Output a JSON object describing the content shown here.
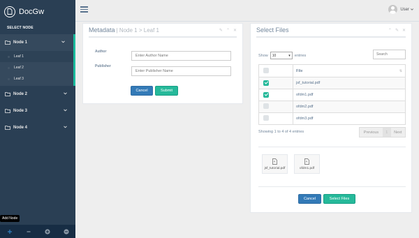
{
  "app": {
    "name": "DocGw"
  },
  "sidebar": {
    "heading": "SELECT NODE",
    "nodes": [
      {
        "label": "Node 1",
        "leaves": [
          {
            "label": "Leaf 1"
          },
          {
            "label": "Leaf 2"
          },
          {
            "label": "Leaf 3"
          }
        ]
      },
      {
        "label": "Node 2"
      },
      {
        "label": "Node 3"
      },
      {
        "label": "Node 4"
      }
    ],
    "tooltip": "Add Node"
  },
  "header": {
    "user": "User"
  },
  "metadata": {
    "title": "Metadata",
    "breadcrumb": "| Node 1 > Leaf 1",
    "author_label": "Author",
    "author_placeholder": "Enter Author Name",
    "publisher_label": "Publisher",
    "publisher_placeholder": "Enter Publisher Name",
    "cancel": "Cancel",
    "submit": "Submit"
  },
  "select_files": {
    "title": "Select Files",
    "show": "Show",
    "page_size": "10",
    "entries": "entries",
    "search_placeholder": "Search",
    "column": "File",
    "rows": [
      {
        "file": "jsf_tutorial.pdf",
        "checked": true
      },
      {
        "file": "ofdm1.pdf",
        "checked": true
      },
      {
        "file": "ofdm2.pdf",
        "checked": false
      },
      {
        "file": "ofdm3.pdf",
        "checked": false
      }
    ],
    "info": "Showing 1 to 4 of 4 entries",
    "prev": "Previous",
    "page": "1",
    "next": "Next",
    "selected": [
      {
        "name": "jsf_tutorial.pdf"
      },
      {
        "name": "ofdm1.pdf"
      }
    ],
    "cancel": "Cancel",
    "select": "Select Files"
  },
  "colors": {
    "sidebar": "#2a3f54",
    "accent": "#1abb9c",
    "primary": "#337ab7",
    "success": "#26b99a"
  }
}
